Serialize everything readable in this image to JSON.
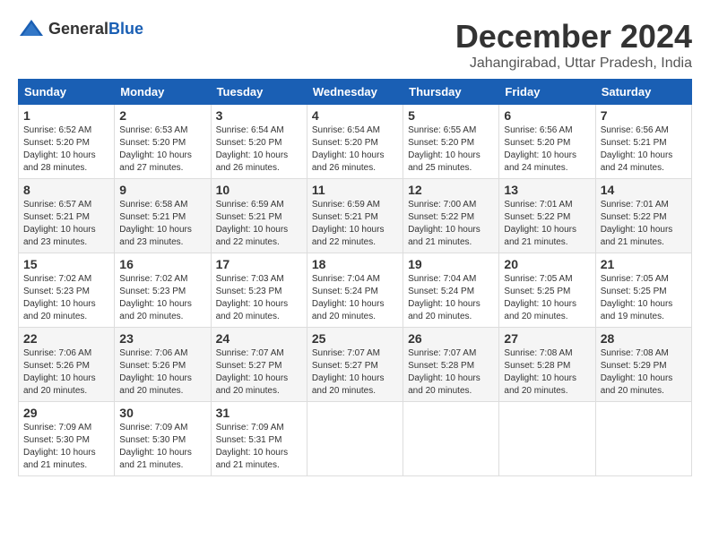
{
  "header": {
    "logo_general": "General",
    "logo_blue": "Blue",
    "month": "December 2024",
    "location": "Jahangirabad, Uttar Pradesh, India"
  },
  "weekdays": [
    "Sunday",
    "Monday",
    "Tuesday",
    "Wednesday",
    "Thursday",
    "Friday",
    "Saturday"
  ],
  "weeks": [
    [
      {
        "day": 1,
        "sunrise": "6:52 AM",
        "sunset": "5:20 PM",
        "daylight": "10 hours and 28 minutes."
      },
      {
        "day": 2,
        "sunrise": "6:53 AM",
        "sunset": "5:20 PM",
        "daylight": "10 hours and 27 minutes."
      },
      {
        "day": 3,
        "sunrise": "6:54 AM",
        "sunset": "5:20 PM",
        "daylight": "10 hours and 26 minutes."
      },
      {
        "day": 4,
        "sunrise": "6:54 AM",
        "sunset": "5:20 PM",
        "daylight": "10 hours and 26 minutes."
      },
      {
        "day": 5,
        "sunrise": "6:55 AM",
        "sunset": "5:20 PM",
        "daylight": "10 hours and 25 minutes."
      },
      {
        "day": 6,
        "sunrise": "6:56 AM",
        "sunset": "5:20 PM",
        "daylight": "10 hours and 24 minutes."
      },
      {
        "day": 7,
        "sunrise": "6:56 AM",
        "sunset": "5:21 PM",
        "daylight": "10 hours and 24 minutes."
      }
    ],
    [
      {
        "day": 8,
        "sunrise": "6:57 AM",
        "sunset": "5:21 PM",
        "daylight": "10 hours and 23 minutes."
      },
      {
        "day": 9,
        "sunrise": "6:58 AM",
        "sunset": "5:21 PM",
        "daylight": "10 hours and 23 minutes."
      },
      {
        "day": 10,
        "sunrise": "6:59 AM",
        "sunset": "5:21 PM",
        "daylight": "10 hours and 22 minutes."
      },
      {
        "day": 11,
        "sunrise": "6:59 AM",
        "sunset": "5:21 PM",
        "daylight": "10 hours and 22 minutes."
      },
      {
        "day": 12,
        "sunrise": "7:00 AM",
        "sunset": "5:22 PM",
        "daylight": "10 hours and 21 minutes."
      },
      {
        "day": 13,
        "sunrise": "7:01 AM",
        "sunset": "5:22 PM",
        "daylight": "10 hours and 21 minutes."
      },
      {
        "day": 14,
        "sunrise": "7:01 AM",
        "sunset": "5:22 PM",
        "daylight": "10 hours and 21 minutes."
      }
    ],
    [
      {
        "day": 15,
        "sunrise": "7:02 AM",
        "sunset": "5:23 PM",
        "daylight": "10 hours and 20 minutes."
      },
      {
        "day": 16,
        "sunrise": "7:02 AM",
        "sunset": "5:23 PM",
        "daylight": "10 hours and 20 minutes."
      },
      {
        "day": 17,
        "sunrise": "7:03 AM",
        "sunset": "5:23 PM",
        "daylight": "10 hours and 20 minutes."
      },
      {
        "day": 18,
        "sunrise": "7:04 AM",
        "sunset": "5:24 PM",
        "daylight": "10 hours and 20 minutes."
      },
      {
        "day": 19,
        "sunrise": "7:04 AM",
        "sunset": "5:24 PM",
        "daylight": "10 hours and 20 minutes."
      },
      {
        "day": 20,
        "sunrise": "7:05 AM",
        "sunset": "5:25 PM",
        "daylight": "10 hours and 20 minutes."
      },
      {
        "day": 21,
        "sunrise": "7:05 AM",
        "sunset": "5:25 PM",
        "daylight": "10 hours and 19 minutes."
      }
    ],
    [
      {
        "day": 22,
        "sunrise": "7:06 AM",
        "sunset": "5:26 PM",
        "daylight": "10 hours and 20 minutes."
      },
      {
        "day": 23,
        "sunrise": "7:06 AM",
        "sunset": "5:26 PM",
        "daylight": "10 hours and 20 minutes."
      },
      {
        "day": 24,
        "sunrise": "7:07 AM",
        "sunset": "5:27 PM",
        "daylight": "10 hours and 20 minutes."
      },
      {
        "day": 25,
        "sunrise": "7:07 AM",
        "sunset": "5:27 PM",
        "daylight": "10 hours and 20 minutes."
      },
      {
        "day": 26,
        "sunrise": "7:07 AM",
        "sunset": "5:28 PM",
        "daylight": "10 hours and 20 minutes."
      },
      {
        "day": 27,
        "sunrise": "7:08 AM",
        "sunset": "5:28 PM",
        "daylight": "10 hours and 20 minutes."
      },
      {
        "day": 28,
        "sunrise": "7:08 AM",
        "sunset": "5:29 PM",
        "daylight": "10 hours and 20 minutes."
      }
    ],
    [
      {
        "day": 29,
        "sunrise": "7:09 AM",
        "sunset": "5:30 PM",
        "daylight": "10 hours and 21 minutes."
      },
      {
        "day": 30,
        "sunrise": "7:09 AM",
        "sunset": "5:30 PM",
        "daylight": "10 hours and 21 minutes."
      },
      {
        "day": 31,
        "sunrise": "7:09 AM",
        "sunset": "5:31 PM",
        "daylight": "10 hours and 21 minutes."
      },
      null,
      null,
      null,
      null
    ]
  ]
}
